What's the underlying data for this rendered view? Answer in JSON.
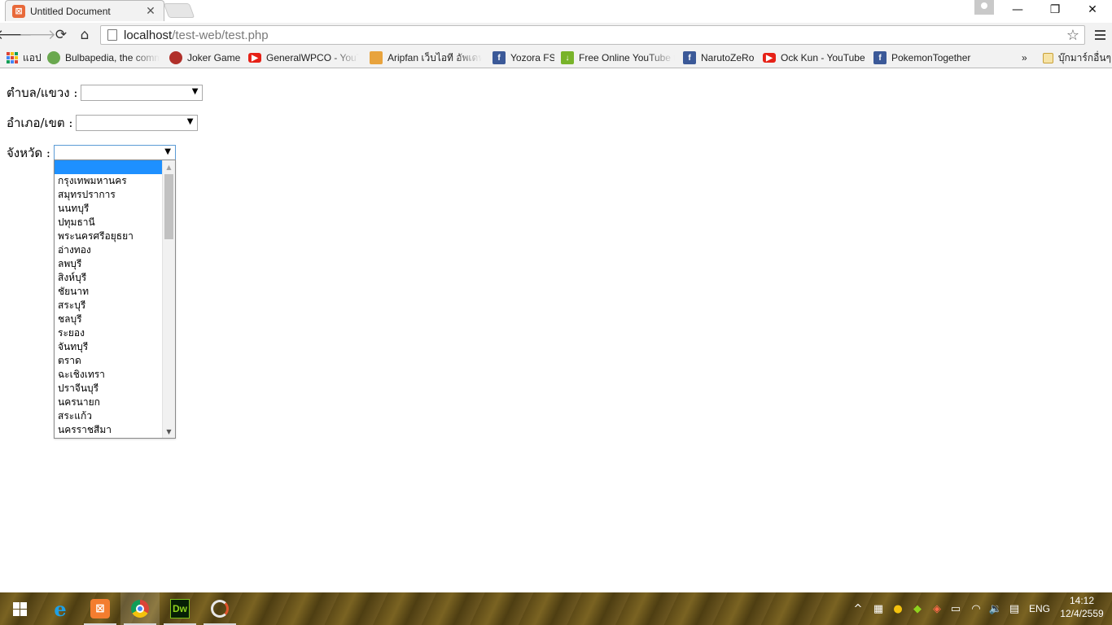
{
  "browser": {
    "tab": {
      "title": "Untitled Document",
      "favicon": "xampp-icon",
      "close_glyph": "✕"
    },
    "window_controls": {
      "minimize": "—",
      "maximize": "❐",
      "close": "✕"
    },
    "url": {
      "host": "localhost",
      "path": "/test-web/test.php"
    }
  },
  "bookmarks": {
    "apps_label": "แอป",
    "items": [
      {
        "label": "Bulbapedia, the comm",
        "icon": "bulbapedia-icon"
      },
      {
        "label": "Joker Game",
        "icon": "joker-icon"
      },
      {
        "label": "GeneralWPCO - YouTu",
        "icon": "youtube-icon"
      },
      {
        "label": "Aripfan เว็บไอที อัพเดทข่",
        "icon": "aripfan-icon"
      },
      {
        "label": "Yozora FS",
        "icon": "facebook-icon"
      },
      {
        "label": "Free Online YouTube t",
        "icon": "download-icon"
      },
      {
        "label": "NarutoZeRo",
        "icon": "facebook-icon"
      },
      {
        "label": "Ock Kun - YouTube",
        "icon": "youtube-icon"
      },
      {
        "label": "PokemonTogether",
        "icon": "facebook-icon"
      }
    ],
    "overflow_glyph": "»",
    "other_bookmarks": "บุ๊กมาร์กอื่นๆ"
  },
  "form": {
    "subdistrict_label": "ตำบล/แขวง :",
    "district_label": "อำเภอ/เขต :",
    "province_label": "จังหวัด :",
    "select_arrow": "▼"
  },
  "province_options": [
    "",
    "กรุงเทพมหานคร",
    "สมุทรปราการ",
    "นนทบุรี",
    "ปทุมธานี",
    "พระนครศรีอยุธยา",
    "อ่างทอง",
    "ลพบุรี",
    "สิงห์บุรี",
    "ชัยนาท",
    "สระบุรี",
    "ชลบุรี",
    "ระยอง",
    "จันทบุรี",
    "ตราด",
    "ฉะเชิงเทรา",
    "ปราจีนบุรี",
    "นครนายก",
    "สระแก้ว",
    "นครราชสีมา"
  ],
  "taskbar": {
    "language": "ENG",
    "time": "14:12",
    "date": "12/4/2559",
    "dw_label": "Dw"
  }
}
